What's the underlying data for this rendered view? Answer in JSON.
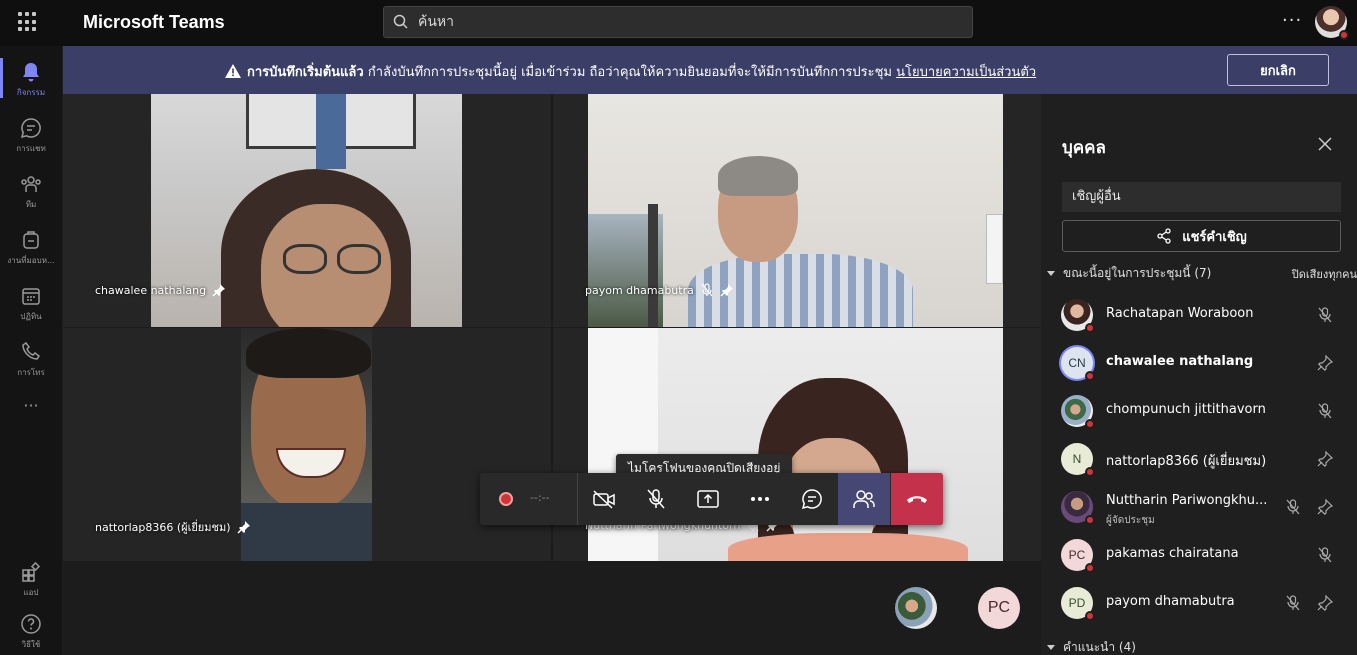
{
  "app": {
    "title": "Microsoft Teams"
  },
  "search": {
    "placeholder": "ค้นหา"
  },
  "topbar": {
    "more": "···"
  },
  "rail": {
    "items": [
      {
        "label": "กิจกรรม",
        "icon": "bell-icon"
      },
      {
        "label": "การแชท",
        "icon": "chat-icon"
      },
      {
        "label": "ทีม",
        "icon": "teams-icon"
      },
      {
        "label": "งานที่มอบห...",
        "icon": "assignments-icon"
      },
      {
        "label": "ปฏิทิน",
        "icon": "calendar-icon"
      },
      {
        "label": "การโทร",
        "icon": "phone-icon"
      },
      {
        "label": "แอป",
        "icon": "apps-icon"
      },
      {
        "label": "วิธีใช้",
        "icon": "help-icon"
      }
    ],
    "more": "···"
  },
  "banner": {
    "bold_text": "การบันทึกเริ่มต้นแล้ว",
    "text": " กำลังบันทึกการประชุมนี้อยู่ เมื่อเข้าร่วม ถือว่าคุณให้ความยินยอมที่จะให้มีการบันทึกการประชุม ",
    "link": "นโยบายความเป็นส่วนตัว",
    "cancel": "ยกเลิก"
  },
  "tiles": [
    {
      "name": "chawalee nathalang"
    },
    {
      "name": "payom dhamabutra"
    },
    {
      "name": "nattorlap8366 (ผู้เยี่ยมชม)"
    },
    {
      "name": "Nuttharin Pariwongkhuntorn"
    }
  ],
  "controls": {
    "timer": "--:--",
    "tooltip": "ไมโครโฟนของคุณปิดเสียงอยู่"
  },
  "bottom": {
    "avatar2_initials": "PC"
  },
  "panel": {
    "title": "บุคคล",
    "invite_placeholder": "เชิญผู้อื่น",
    "share_invite": "แชร์คำเชิญ",
    "in_meeting": "ขณะนี้อยู่ในการประชุมนี้ (7)",
    "mute_all": "ปิดเสียงทุกคน",
    "suggestions": "คำแนะนำ (4)",
    "people": [
      {
        "name": "Rachatapan Woraboon",
        "initials": "",
        "role": ""
      },
      {
        "name": "chawalee nathalang",
        "initials": "CN",
        "role": ""
      },
      {
        "name": "chompunuch jittithavorn",
        "initials": "",
        "role": ""
      },
      {
        "name": "nattorlap8366 (ผู้เยี่ยมชม)",
        "initials": "N",
        "role": ""
      },
      {
        "name": "Nuttharin Pariwongkhu...",
        "initials": "",
        "role": "ผู้จัดประชุม"
      },
      {
        "name": "pakamas chairatana",
        "initials": "PC",
        "role": ""
      },
      {
        "name": "payom dhamabutra",
        "initials": "PD",
        "role": ""
      }
    ]
  },
  "colors": {
    "accent": "#7f85f5",
    "banner": "#3b3e66",
    "hangup": "#c4314b",
    "people_active": "#464775"
  }
}
